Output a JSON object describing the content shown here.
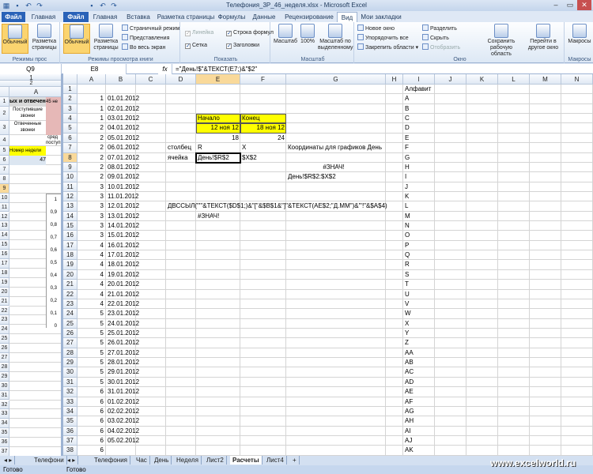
{
  "window": {
    "title": "Телефония_3Р_46_неделя.xlsx - Microsoft Excel",
    "minimize": "–",
    "restore": "▭",
    "close": "✕"
  },
  "tabs": [
    "Файл",
    "Главная",
    "Вставка",
    "Разметка страницы",
    "Формулы",
    "Данные",
    "Рецензирование",
    "Вид",
    "Мои закладки"
  ],
  "left_pane_tabs": [
    "Файл",
    "Главная"
  ],
  "ribbon": {
    "views_left_label": "Режимы прос",
    "views_label": "Режимы просмотра книги",
    "normal": "Обычный",
    "page_layout": "Разметка страницы",
    "page_layout_left": "Разметка страницы",
    "normal_left": "Обычный",
    "page_break": "Страничный режим",
    "custom_views": "Представления",
    "full_screen": "Во весь экран",
    "show_label": "Показать",
    "ruler": "Линейка",
    "formula_bar": "Строка формул",
    "gridlines": "Сетка",
    "headings": "Заголовки",
    "zoom_label": "Масштаб",
    "zoom": "Масштаб",
    "zoom100": "100%",
    "zoom_sel": "Масштаб по выделенному",
    "window_label": "Окно",
    "new_window": "Новое окно",
    "arrange_all": "Упорядочить все",
    "freeze": "Закрепить области",
    "split": "Разделить",
    "hide": "Скрыть",
    "unhide": "Отобразить",
    "save_ws": "Сохранить рабочую область",
    "switch": "Перейти в другое окно",
    "macros_label": "Макросы",
    "macros": "Макросы"
  },
  "formula_bar": {
    "namebox_left": "Q9",
    "namebox": "E8",
    "fx": "fx",
    "formula": "=\"День!$\"&ТЕКСТ(E7;)&\"$2\""
  },
  "left_pane": {
    "cols": [
      "A"
    ],
    "rows": [
      "1",
      "2",
      "3",
      "4",
      "5",
      "6",
      "7",
      "8",
      "9",
      "10",
      "11",
      "12",
      "13",
      "14",
      "15",
      "16",
      "17",
      "18",
      "19",
      "20",
      "21",
      "22",
      "23",
      "24",
      "25",
      "26",
      "27",
      "28",
      "29",
      "30",
      "31",
      "32",
      "33",
      "34",
      "35",
      "36",
      "37",
      "38"
    ],
    "header_text": "ых и отвечен",
    "header_text2": "45 не",
    "r2": "Поступившие звонки",
    "r3": "Отвеченные звонки",
    "r4": "сред",
    "r4b": "поступ",
    "r5": "Номер недели",
    "r6": "47",
    "chart_ticks": [
      "1",
      "0,9",
      "0,8",
      "0,7",
      "0,6",
      "0,5",
      "0,4",
      "0,3",
      "0,2",
      "0,1",
      "0"
    ]
  },
  "grid": {
    "cols": [
      "A",
      "B",
      "C",
      "D",
      "E",
      "F",
      "G",
      "H",
      "I",
      "J",
      "K",
      "L",
      "M",
      "N"
    ],
    "rows": [
      "1",
      "2",
      "3",
      "4",
      "5",
      "6",
      "7",
      "8",
      "9",
      "10",
      "11",
      "12",
      "13",
      "14",
      "15",
      "16",
      "17",
      "18",
      "19",
      "20",
      "21",
      "22",
      "23",
      "24",
      "25",
      "26",
      "27",
      "28",
      "29",
      "30",
      "31",
      "32",
      "33",
      "34",
      "35",
      "36",
      "37",
      "38"
    ],
    "col_a": [
      "",
      "1",
      "1",
      "1",
      "2",
      "2",
      "2",
      "2",
      "2",
      "2",
      "3",
      "3",
      "3",
      "3",
      "3",
      "3",
      "4",
      "4",
      "4",
      "4",
      "4",
      "4",
      "4",
      "5",
      "5",
      "5",
      "5",
      "5",
      "5",
      "5",
      "5",
      "6",
      "6",
      "6",
      "6",
      "6",
      "6",
      "6"
    ],
    "col_b": [
      "",
      "01.01.2012",
      "02.01.2012",
      "03.01.2012",
      "04.01.2012",
      "05.01.2012",
      "06.01.2012",
      "07.01.2012",
      "08.01.2012",
      "09.01.2012",
      "10.01.2012",
      "11.01.2012",
      "12.01.2012",
      "13.01.2012",
      "14.01.2012",
      "15.01.2012",
      "16.01.2012",
      "17.01.2012",
      "18.01.2012",
      "19.01.2012",
      "20.01.2012",
      "21.01.2012",
      "22.01.2012",
      "23.01.2012",
      "24.01.2012",
      "25.01.2012",
      "26.01.2012",
      "27.01.2012",
      "28.01.2012",
      "29.01.2012",
      "30.01.2012",
      "31.01.2012",
      "01.02.2012",
      "02.02.2012",
      "03.02.2012",
      "04.02.2012",
      "05.02.2012"
    ],
    "col_i": [
      "Алфавит",
      "A",
      "B",
      "C",
      "D",
      "E",
      "F",
      "G",
      "H",
      "I",
      "J",
      "K",
      "L",
      "M",
      "N",
      "O",
      "P",
      "Q",
      "R",
      "S",
      "T",
      "U",
      "V",
      "W",
      "X",
      "Y",
      "Z",
      "AA",
      "AB",
      "AC",
      "AD",
      "AE",
      "AF",
      "AG",
      "AH",
      "AI",
      "AJ",
      "AK"
    ],
    "e4": "Начало",
    "f4": "Конец",
    "e5": "12 ноя 12",
    "f5": "18 ноя 12",
    "e6": "18",
    "f6": "24",
    "d7": "столбец",
    "e7": "R",
    "f7": "X",
    "g7": "Координаты для графиков День",
    "d8": "ячейка",
    "e8": "День!$R$2",
    "f8": "$X$2",
    "g9": "#ЗНАЧ!",
    "g10": "День!$R$2:$X$2",
    "d13": "ДВССЫЛ(\"'\"&ТЕКСТ($D$1;)&\"[\"&$B$1&\"]\"&ТЕКСТ(AE$2;\"Д.ММ\")&\"'!\"&$A$4)",
    "e14": "#ЗНАЧ!"
  },
  "sheet_tabs_left": [
    "Телефони"
  ],
  "sheet_tabs": [
    "Телефония",
    "Час",
    "День",
    "Неделя",
    "Лист2",
    "Расчеты",
    "Лист4"
  ],
  "active_sheet": "Расчеты",
  "status": {
    "left": "Готово",
    "right": "Готово"
  },
  "watermark": "www.excelworld.ru",
  "colors": {
    "yellow": "#ffff00",
    "pink": "#e6b8b7",
    "file_tab": "#2a62b8"
  }
}
